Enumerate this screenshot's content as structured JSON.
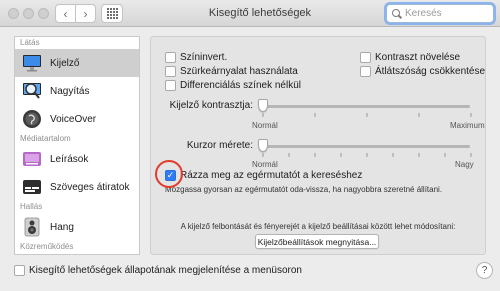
{
  "window": {
    "title": "Kisegítő lehetőségek"
  },
  "search": {
    "placeholder": "Keresés"
  },
  "sidebar": {
    "sections": [
      {
        "header": "Látás",
        "items": [
          {
            "label": "Kijelző",
            "icon": "display-icon",
            "selected": true
          },
          {
            "label": "Nagyítás",
            "icon": "magnifier-icon",
            "selected": false
          },
          {
            "label": "VoiceOver",
            "icon": "voiceover-icon",
            "selected": false
          }
        ]
      },
      {
        "header": "Médiatartalom",
        "items": [
          {
            "label": "Leírások",
            "icon": "descriptions-icon",
            "selected": false
          },
          {
            "label": "Szöveges átiratok",
            "icon": "captions-icon",
            "selected": false
          }
        ]
      },
      {
        "header": "Hallás",
        "items": [
          {
            "label": "Hang",
            "icon": "speaker-icon",
            "selected": false
          }
        ]
      },
      {
        "header": "Közreműködés",
        "items": []
      }
    ]
  },
  "options": {
    "invert": {
      "label": "Színinvert.",
      "checked": false
    },
    "grayscale": {
      "label": "Szürkeárnyalat használata",
      "checked": false
    },
    "differentiate": {
      "label": "Differenciálás színek nélkül",
      "checked": false
    },
    "contrast": {
      "label": "Kontraszt növelése",
      "checked": false
    },
    "transparency": {
      "label": "Átlátszóság csökkentése",
      "checked": false
    }
  },
  "sliders": {
    "contrast": {
      "label": "Kijelző kontrasztja:",
      "min_label": "Normál",
      "max_label": "Maximum",
      "value": 0
    },
    "cursor": {
      "label": "Kurzor mérete:",
      "min_label": "Normál",
      "max_label": "Nagy",
      "value": 0
    }
  },
  "shake": {
    "label": "Rázza meg az egérmutatót a kereséshez",
    "checked": true,
    "description": "Mozgassa gyorsan az egérmutatót oda-vissza, ha nagyobbra szeretné állítani."
  },
  "display_note": "A kijelző felbontását és fényerejét a kijelző beállításai között lehet módosítani:",
  "display_button": "Kijelzőbeállítások megnyitása...",
  "bottom": {
    "label": "Kisegítő lehetőségek állapotának megjelenítése a menüsoron",
    "checked": false
  },
  "help": "?",
  "colors": {
    "accent": "#2f7cf6",
    "annotation": "#e23b2e",
    "selected_row": "#cfcfcf"
  }
}
